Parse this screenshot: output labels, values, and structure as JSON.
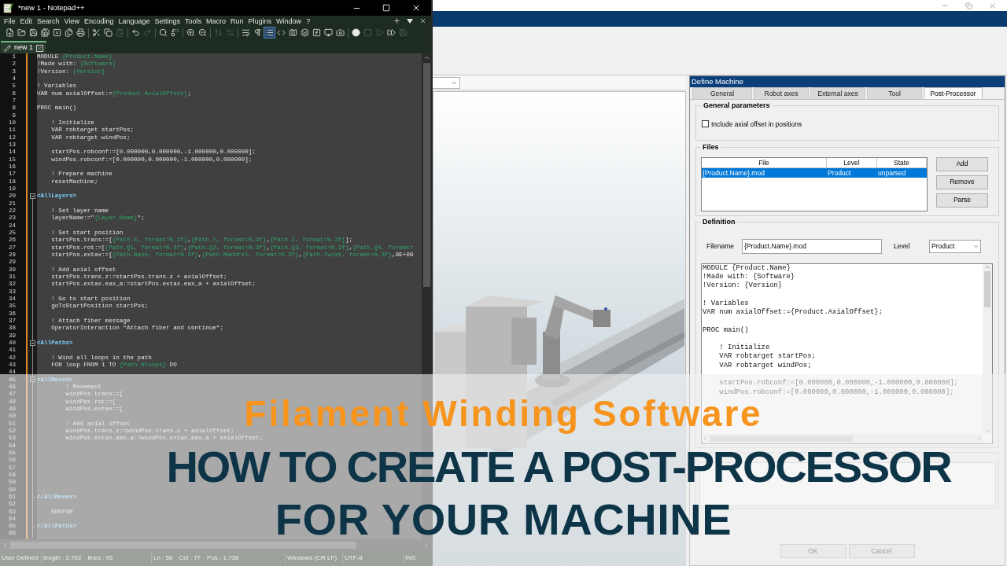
{
  "notepad": {
    "title": "*new 1 - Notepad++",
    "menu": [
      "File",
      "Edit",
      "Search",
      "View",
      "Encoding",
      "Language",
      "Settings",
      "Tools",
      "Macro",
      "Run",
      "Plugins",
      "Window",
      "?"
    ],
    "toolbar": [
      [
        {
          "kind": "new",
          "disabled": false,
          "on": false
        },
        {
          "kind": "open",
          "disabled": false,
          "on": false
        },
        {
          "kind": "save",
          "disabled": false,
          "on": false
        },
        {
          "kind": "saveall",
          "disabled": false,
          "on": false
        },
        {
          "kind": "close",
          "disabled": false,
          "on": false
        },
        {
          "kind": "closeall",
          "disabled": false,
          "on": false
        },
        {
          "kind": "print",
          "disabled": false,
          "on": false
        }
      ],
      [
        {
          "kind": "cut",
          "disabled": false,
          "on": false
        },
        {
          "kind": "copy",
          "disabled": false,
          "on": false
        },
        {
          "kind": "paste",
          "disabled": true,
          "on": false
        }
      ],
      [
        {
          "kind": "undo",
          "disabled": false,
          "on": false
        },
        {
          "kind": "redo",
          "disabled": true,
          "on": false
        }
      ],
      [
        {
          "kind": "find",
          "disabled": false,
          "on": false
        },
        {
          "kind": "replace",
          "disabled": false,
          "on": false
        }
      ],
      [
        {
          "kind": "zoomin",
          "disabled": false,
          "on": false
        },
        {
          "kind": "zoomout",
          "disabled": false,
          "on": false
        }
      ],
      [
        {
          "kind": "syncv",
          "disabled": true,
          "on": false
        },
        {
          "kind": "synch",
          "disabled": true,
          "on": false
        }
      ],
      [
        {
          "kind": "wrap",
          "disabled": false,
          "on": false
        },
        {
          "kind": "allchars",
          "disabled": false,
          "on": false
        },
        {
          "kind": "indentguide",
          "disabled": false,
          "on": true
        },
        {
          "kind": "xml",
          "disabled": false,
          "on": false
        },
        {
          "kind": "docmap",
          "disabled": false,
          "on": false
        },
        {
          "kind": "doclist",
          "disabled": false,
          "on": false
        },
        {
          "kind": "function",
          "disabled": false,
          "on": false
        },
        {
          "kind": "workspace",
          "disabled": false,
          "on": false
        },
        {
          "kind": "monitor",
          "disabled": false,
          "on": false
        }
      ],
      [
        {
          "kind": "record",
          "disabled": false,
          "on": false
        },
        {
          "kind": "stop",
          "disabled": true,
          "on": false
        },
        {
          "kind": "play",
          "disabled": true,
          "on": false
        },
        {
          "kind": "playmulti",
          "disabled": false,
          "on": false
        },
        {
          "kind": "savemacro",
          "disabled": true,
          "on": false
        }
      ]
    ],
    "tabs": [
      {
        "label": "new 1",
        "selected": true
      }
    ],
    "lines": [
      {
        "number": "1",
        "kind": "text",
        "tokens": [
          {
            "kind": "code",
            "text": "MODULE "
          },
          {
            "kind": "placeholder",
            "text": "{Product.Name}"
          }
        ]
      },
      {
        "number": "2",
        "kind": "text",
        "tokens": [
          {
            "kind": "code",
            "text": "!Made with: "
          },
          {
            "kind": "placeholder",
            "text": "{Software}"
          }
        ]
      },
      {
        "number": "3",
        "kind": "text",
        "tokens": [
          {
            "kind": "code",
            "text": "!Version: "
          },
          {
            "kind": "placeholder",
            "text": "{Version}"
          }
        ]
      },
      {
        "number": "4",
        "kind": "text"
      },
      {
        "number": "5",
        "kind": "text",
        "tokens": [
          {
            "kind": "code",
            "text": "! Variables"
          }
        ]
      },
      {
        "number": "6",
        "kind": "text",
        "tokens": [
          {
            "kind": "code",
            "text": "VAR num axialOffset:="
          },
          {
            "kind": "placeholder",
            "text": "{Product.AxialOffset}"
          },
          {
            "kind": "code",
            "text": ";"
          }
        ]
      },
      {
        "number": "7",
        "kind": "text"
      },
      {
        "number": "8",
        "kind": "text",
        "tokens": [
          {
            "kind": "code",
            "text": "PROC main()"
          }
        ]
      },
      {
        "number": "9",
        "kind": "text"
      },
      {
        "number": "10",
        "kind": "text",
        "tokens": [
          {
            "kind": "code",
            "text": "    ! Initialize"
          }
        ]
      },
      {
        "number": "11",
        "kind": "text",
        "tokens": [
          {
            "kind": "code",
            "text": "    VAR robtarget startPos;"
          }
        ]
      },
      {
        "number": "12",
        "kind": "text",
        "tokens": [
          {
            "kind": "code",
            "text": "    VAR robtarget windPos;"
          }
        ]
      },
      {
        "number": "13",
        "kind": "text"
      },
      {
        "number": "14",
        "kind": "text",
        "tokens": [
          {
            "kind": "code",
            "text": "    startPos.robconf:=[0.000000,0.000000,-1.000000,0.000000];"
          }
        ]
      },
      {
        "number": "15",
        "kind": "text",
        "tokens": [
          {
            "kind": "code",
            "text": "    windPos.robconf:=[0.000000,0.000000,-1.000000,0.000000];"
          }
        ]
      },
      {
        "number": "16",
        "kind": "text"
      },
      {
        "number": "17",
        "kind": "text",
        "tokens": [
          {
            "kind": "code",
            "text": "    ! Prepare machine"
          }
        ]
      },
      {
        "number": "18",
        "kind": "text",
        "tokens": [
          {
            "kind": "code",
            "text": "    resetMachine;"
          }
        ]
      },
      {
        "number": "19",
        "kind": "text"
      },
      {
        "number": "20",
        "kind": "foldstart",
        "tokens": [
          {
            "kind": "tag",
            "text": "<AllLayers>"
          }
        ]
      },
      {
        "number": "21",
        "kind": "text"
      },
      {
        "number": "22",
        "kind": "text",
        "tokens": [
          {
            "kind": "code",
            "text": "    ! Set layer name"
          }
        ]
      },
      {
        "number": "23",
        "kind": "text",
        "tokens": [
          {
            "kind": "code",
            "text": "    layerName:=\""
          },
          {
            "kind": "placeholder",
            "text": "{Layer.Name}"
          },
          {
            "kind": "code",
            "text": "\";"
          }
        ]
      },
      {
        "number": "24",
        "kind": "text"
      },
      {
        "number": "25",
        "kind": "text",
        "tokens": [
          {
            "kind": "code",
            "text": "    ! Set start position"
          }
        ]
      },
      {
        "number": "26",
        "kind": "text",
        "tokens": [
          {
            "kind": "code",
            "text": "    startPos.trans:=["
          },
          {
            "kind": "placeholder",
            "text": "{Path.X, format=%.3f}"
          },
          {
            "kind": "code",
            "text": ","
          },
          {
            "kind": "placeholder",
            "text": "{Path.Y, format=%.3f}"
          },
          {
            "kind": "code",
            "text": ","
          },
          {
            "kind": "placeholder",
            "text": "{Path.Z, format=%.3f}"
          },
          {
            "kind": "code",
            "text": "];"
          }
        ]
      },
      {
        "number": "27",
        "kind": "text",
        "tokens": [
          {
            "kind": "code",
            "text": "    startPos.rot:=["
          },
          {
            "kind": "placeholder",
            "text": "{Path.Q1, format=%.3f}"
          },
          {
            "kind": "code",
            "text": ","
          },
          {
            "kind": "placeholder",
            "text": "{Path.Q2, format=%.3f}"
          },
          {
            "kind": "code",
            "text": ","
          },
          {
            "kind": "placeholder",
            "text": "{Path.Q3, format=%.3f}"
          },
          {
            "kind": "code",
            "text": ","
          },
          {
            "kind": "placeholder",
            "text": "{Path.Q4, format="
          }
        ]
      },
      {
        "number": "28",
        "kind": "text",
        "tokens": [
          {
            "kind": "code",
            "text": "    startPos.extax:=["
          },
          {
            "kind": "placeholder",
            "text": "{Path.Base, format=%.3f}"
          },
          {
            "kind": "code",
            "text": ","
          },
          {
            "kind": "placeholder",
            "text": "{Path.Mandrel, format=%.3f}"
          },
          {
            "kind": "code",
            "text": ","
          },
          {
            "kind": "placeholder",
            "text": "{Path.Twist, format=%.3f}"
          },
          {
            "kind": "code",
            "text": ",9E+09"
          }
        ]
      },
      {
        "number": "29",
        "kind": "text"
      },
      {
        "number": "30",
        "kind": "text",
        "tokens": [
          {
            "kind": "code",
            "text": "    ! Add axial offset"
          }
        ]
      },
      {
        "number": "31",
        "kind": "text",
        "tokens": [
          {
            "kind": "code",
            "text": "    startPos.trans.z:=startPos.trans.z + axialOffset;"
          }
        ]
      },
      {
        "number": "32",
        "kind": "text",
        "tokens": [
          {
            "kind": "code",
            "text": "    startPos.extax.eax_a:=startPos.extax.eax_a + axialOffset;"
          }
        ]
      },
      {
        "number": "33",
        "kind": "text"
      },
      {
        "number": "34",
        "kind": "text",
        "tokens": [
          {
            "kind": "code",
            "text": "    ! Go to start position"
          }
        ]
      },
      {
        "number": "35",
        "kind": "text",
        "tokens": [
          {
            "kind": "code",
            "text": "    goToStartPosition startPos;"
          }
        ]
      },
      {
        "number": "36",
        "kind": "text"
      },
      {
        "number": "37",
        "kind": "text",
        "tokens": [
          {
            "kind": "code",
            "text": "    ! Attach fiber message"
          }
        ]
      },
      {
        "number": "38",
        "kind": "text",
        "tokens": [
          {
            "kind": "code",
            "text": "    OperatorInteraction \"Attach fiber and continue\";"
          }
        ]
      },
      {
        "number": "39",
        "kind": "text"
      },
      {
        "number": "40",
        "kind": "foldstart",
        "tokens": [
          {
            "kind": "tag",
            "text": "<AllPaths>"
          }
        ]
      },
      {
        "number": "41",
        "kind": "text"
      },
      {
        "number": "42",
        "kind": "text",
        "tokens": [
          {
            "kind": "code",
            "text": "    ! Wind all loops in the path"
          }
        ]
      },
      {
        "number": "43",
        "kind": "text",
        "tokens": [
          {
            "kind": "code",
            "text": "    FOR loop FROM 1 TO "
          },
          {
            "kind": "placeholder",
            "text": "{Path.Nloops}"
          },
          {
            "kind": "code",
            "text": " DO"
          }
        ]
      },
      {
        "number": "44",
        "kind": "text"
      },
      {
        "number": "45",
        "kind": "foldstart",
        "tokens": [
          {
            "kind": "tag",
            "text": "<AllMoves>"
          }
        ]
      },
      {
        "number": "46",
        "kind": "text",
        "tokens": [
          {
            "kind": "code",
            "text": "        ! Movement"
          }
        ]
      },
      {
        "number": "47",
        "kind": "text",
        "tokens": [
          {
            "kind": "code",
            "text": "        windPos.trans:=["
          }
        ]
      },
      {
        "number": "48",
        "kind": "text",
        "tokens": [
          {
            "kind": "code",
            "text": "        windPos.rot:=["
          }
        ]
      },
      {
        "number": "49",
        "kind": "text",
        "tokens": [
          {
            "kind": "code",
            "text": "        windPos.extax:=["
          }
        ]
      },
      {
        "number": "50",
        "kind": "text"
      },
      {
        "number": "51",
        "kind": "text",
        "tokens": [
          {
            "kind": "code",
            "text": "        ! Add axial offset"
          }
        ]
      },
      {
        "number": "52",
        "kind": "text",
        "tokens": [
          {
            "kind": "code",
            "text": "        windPos.trans.z:=windPos.trans.z + axialOffset;"
          }
        ]
      },
      {
        "number": "53",
        "kind": "text",
        "tokens": [
          {
            "kind": "code",
            "text": "        windPos.extax.eax_a:=windPos.extax.eax_a + axialOffset;"
          }
        ]
      },
      {
        "number": "54",
        "kind": "text"
      },
      {
        "number": "55",
        "kind": "text"
      },
      {
        "number": "56",
        "kind": "text"
      },
      {
        "number": "57",
        "kind": "text"
      },
      {
        "number": "58",
        "kind": "text"
      },
      {
        "number": "59",
        "kind": "text"
      },
      {
        "number": "60",
        "kind": "text"
      },
      {
        "number": "61",
        "kind": "foldend",
        "tokens": [
          {
            "kind": "tag",
            "text": "</AllMoves>"
          }
        ]
      },
      {
        "number": "62",
        "kind": "text"
      },
      {
        "number": "63",
        "kind": "text",
        "tokens": [
          {
            "kind": "code",
            "text": "    ENDFOR"
          }
        ]
      },
      {
        "number": "64",
        "kind": "text"
      },
      {
        "number": "65",
        "kind": "foldend",
        "tokens": [
          {
            "kind": "tag",
            "text": "</AllPaths>"
          }
        ]
      },
      {
        "number": "66",
        "kind": "text"
      }
    ],
    "status_bar": [
      [
        "User Defined"
      ],
      [
        "length : 2,702",
        "lines : 95"
      ],
      [
        "Ln : 56",
        "Col : 77",
        "Pos : 1,738"
      ],
      [
        "Windows (CR LF)"
      ],
      [
        "UTF-8"
      ],
      [
        "INS"
      ]
    ]
  },
  "main_window": {
    "define_machine": {
      "title": "Define Machine",
      "tabs": [
        {
          "label": "General",
          "selected": false
        },
        {
          "label": "Robot axes",
          "selected": false
        },
        {
          "label": "External axes",
          "selected": false
        },
        {
          "label": "Tool",
          "selected": false
        },
        {
          "label": "Post-Processor",
          "selected": true
        }
      ],
      "general_parameters": {
        "title": "General parameters",
        "checkbox": {
          "label": "Include axial offset in positions",
          "checked": false
        }
      },
      "files": {
        "title": "Files",
        "columns": [
          "File",
          "Level",
          "State"
        ],
        "rows": [
          {
            "cells": [
              "{Product.Name}.mod",
              "Product",
              "unparsed"
            ],
            "selected": true
          }
        ],
        "buttons": [
          "Add",
          "Remove",
          "Parse"
        ]
      },
      "definition": {
        "title": "Definition",
        "filename_label": "Filename",
        "filename": "{Product.Name}.mod",
        "level_label": "Level",
        "level": "Product",
        "code": "MODULE {Product.Name}\n!Made with: {Software}\n!Version: {Version}\n\n! Variables\nVAR num axialOffset:={Product.AxialOffset};\n\nPROC main()\n\n    ! Initialize\n    VAR robtarget startPos;\n    VAR robtarget windPos;\n\n    startPos.robconf:=[0.000000,0.000000,-1.000000,0.000000];\n    windPos.robconf:=[0.000000,0.000000,-1.000000,0.000000];"
      },
      "buttons": [
        "OK",
        "Cancel"
      ]
    }
  },
  "banner": {
    "subtitle": "Filament Winding Software",
    "headline": [
      "HOW TO CREATE A POST-PROCESSOR",
      "FOR YOUR MACHINE"
    ]
  }
}
